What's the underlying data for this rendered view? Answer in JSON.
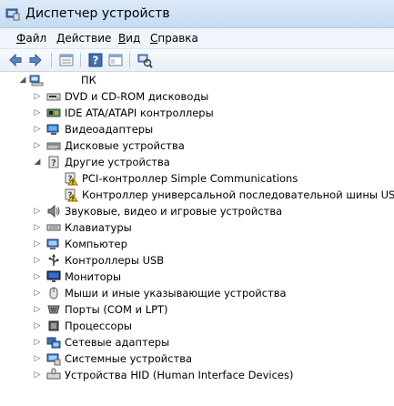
{
  "window": {
    "title": "Диспетчер устройств"
  },
  "menu": [
    {
      "label": "Файл",
      "key": "Ф",
      "rest": "айл"
    },
    {
      "label": "Действие",
      "key": "Д",
      "rest": "ействие"
    },
    {
      "label": "Вид",
      "key": "В",
      "rest": "ид"
    },
    {
      "label": "Справка",
      "key": "С",
      "rest": "правка"
    }
  ],
  "toolbar_icons": [
    "back-arrow-icon",
    "forward-arrow-icon",
    "properties-icon",
    "help-icon",
    "console-tree-icon",
    "scan-hardware-icon"
  ],
  "tree": {
    "root": "ПК",
    "items": [
      {
        "label": "DVD и CD-ROM дисководы",
        "icon": "dvd-drive-icon",
        "level": 1,
        "expanded": false
      },
      {
        "label": "IDE ATA/ATAPI контроллеры",
        "icon": "ide-controller-icon",
        "level": 1,
        "expanded": false
      },
      {
        "label": "Видеоадаптеры",
        "icon": "display-adapter-icon",
        "level": 1,
        "expanded": false
      },
      {
        "label": "Дисковые устройства",
        "icon": "disk-drive-icon",
        "level": 1,
        "expanded": false
      },
      {
        "label": "Другие устройства",
        "icon": "other-devices-icon",
        "level": 1,
        "expanded": true
      },
      {
        "label": "PCI-контроллер Simple Communications",
        "icon": "unknown-device-warning-icon",
        "level": 2
      },
      {
        "label": "Контроллер универсальной последовательной шины USB",
        "icon": "unknown-device-warning-icon",
        "level": 2
      },
      {
        "label": "Звуковые, видео и игровые устройства",
        "icon": "sound-device-icon",
        "level": 1,
        "expanded": false
      },
      {
        "label": "Клавиатуры",
        "icon": "keyboard-icon",
        "level": 1,
        "expanded": false
      },
      {
        "label": "Компьютер",
        "icon": "computer-icon",
        "level": 1,
        "expanded": false
      },
      {
        "label": "Контроллеры USB",
        "icon": "usb-controller-icon",
        "level": 1,
        "expanded": false
      },
      {
        "label": "Мониторы",
        "icon": "monitor-icon",
        "level": 1,
        "expanded": false
      },
      {
        "label": "Мыши и иные указывающие устройства",
        "icon": "mouse-icon",
        "level": 1,
        "expanded": false
      },
      {
        "label": "Порты (COM и LPT)",
        "icon": "port-icon",
        "level": 1,
        "expanded": false
      },
      {
        "label": "Процессоры",
        "icon": "processor-icon",
        "level": 1,
        "expanded": false
      },
      {
        "label": "Сетевые адаптеры",
        "icon": "network-adapter-icon",
        "level": 1,
        "expanded": false
      },
      {
        "label": "Системные устройства",
        "icon": "system-device-icon",
        "level": 1,
        "expanded": false
      },
      {
        "label": "Устройства HID (Human Interface Devices)",
        "icon": "hid-device-icon",
        "level": 1,
        "expanded": false
      }
    ]
  },
  "colors": {
    "title_bg": "#c6dcf2",
    "menu_bg": "#f1f5fb",
    "warning": "#f2c200",
    "icon_blue": "#3a6fb5"
  }
}
